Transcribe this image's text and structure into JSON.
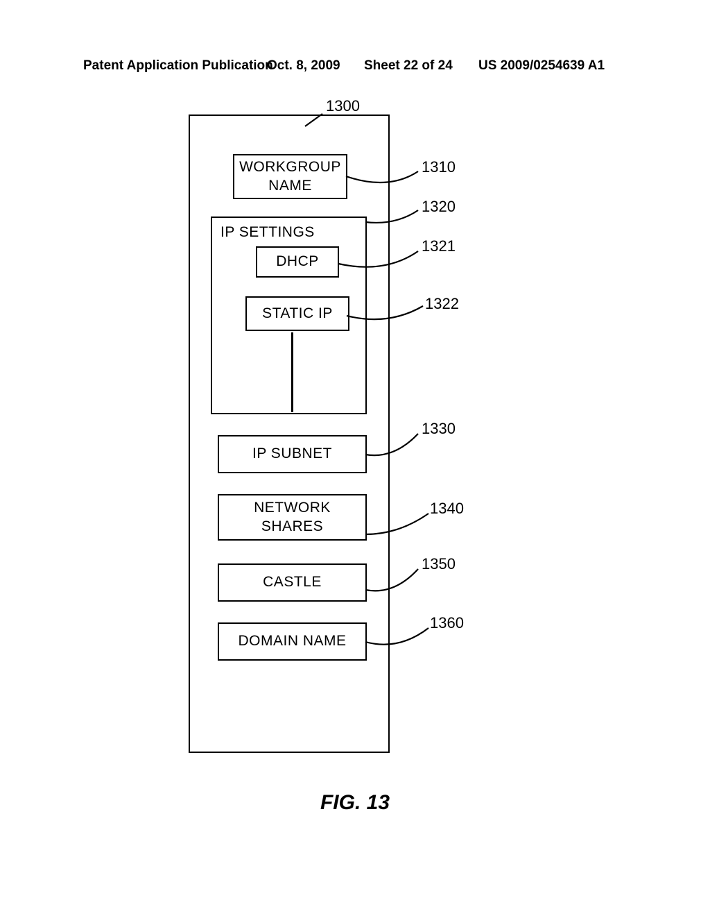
{
  "header": {
    "left": "Patent Application Publication",
    "date": "Oct. 8, 2009",
    "sheet": "Sheet 22 of 24",
    "pubno": "US 2009/0254639 A1"
  },
  "figure": {
    "label": "FIG. 13"
  },
  "boxes": {
    "workgroup": "WORKGROUP\nNAME",
    "ipsettings": "IP SETTINGS",
    "dhcp": "DHCP",
    "staticip": "STATIC IP",
    "ipsubnet": "IP SUBNET",
    "netshares": "NETWORK\nSHARES",
    "castle": "CASTLE",
    "domain": "DOMAIN NAME"
  },
  "callouts": {
    "c1300": "1300",
    "c1310": "1310",
    "c1320": "1320",
    "c1321": "1321",
    "c1322": "1322",
    "c1330": "1330",
    "c1340": "1340",
    "c1350": "1350",
    "c1360": "1360"
  }
}
